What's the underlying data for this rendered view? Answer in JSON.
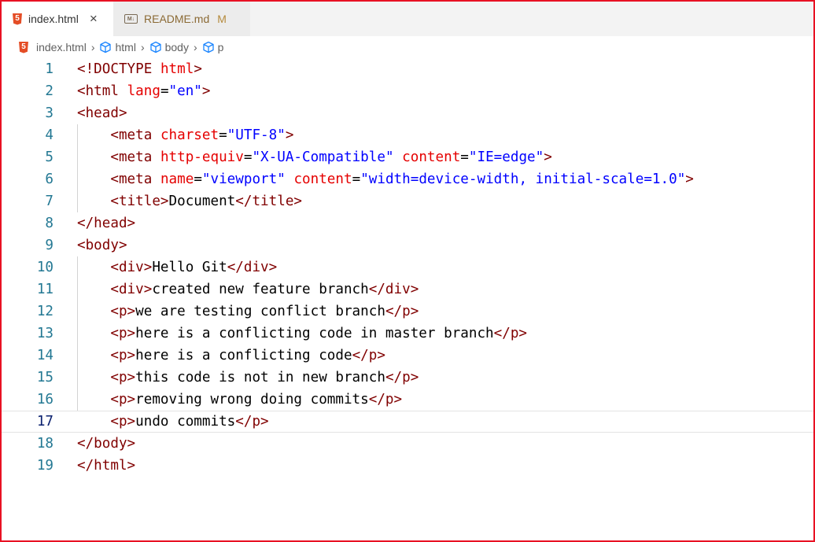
{
  "tabs": [
    {
      "label": "index.html",
      "close": "×",
      "active": true
    },
    {
      "label": "README.md",
      "status": "M",
      "active": false
    }
  ],
  "breadcrumb": [
    "index.html",
    "html",
    "body",
    "p"
  ],
  "breadcrumb_separator": "›",
  "colors": {
    "tag": "#800000",
    "attribute": "#e50000",
    "string": "#0000ff",
    "line_number": "#237893",
    "html_icon": "#e44d26",
    "frame_border": "#e81123"
  },
  "active_line": 17,
  "lines": [
    {
      "n": "1",
      "segs": [
        [
          "tg",
          "<!DOCTYPE "
        ],
        [
          "at",
          "html"
        ],
        [
          "tg",
          ">"
        ]
      ]
    },
    {
      "n": "2",
      "segs": [
        [
          "tg",
          "<html "
        ],
        [
          "at",
          "lang"
        ],
        [
          "tx",
          "="
        ],
        [
          "st",
          "\"en\""
        ],
        [
          "tg",
          ">"
        ]
      ]
    },
    {
      "n": "3",
      "segs": [
        [
          "tg",
          "<head>"
        ]
      ]
    },
    {
      "n": "4",
      "segs": [
        [
          "tx",
          "    "
        ],
        [
          "tg",
          "<meta "
        ],
        [
          "at",
          "charset"
        ],
        [
          "tx",
          "="
        ],
        [
          "st",
          "\"UTF-8\""
        ],
        [
          "tg",
          ">"
        ]
      ]
    },
    {
      "n": "5",
      "segs": [
        [
          "tx",
          "    "
        ],
        [
          "tg",
          "<meta "
        ],
        [
          "at",
          "http-equiv"
        ],
        [
          "tx",
          "="
        ],
        [
          "st",
          "\"X-UA-Compatible\""
        ],
        [
          "tx",
          " "
        ],
        [
          "at",
          "content"
        ],
        [
          "tx",
          "="
        ],
        [
          "st",
          "\"IE=edge\""
        ],
        [
          "tg",
          ">"
        ]
      ]
    },
    {
      "n": "6",
      "segs": [
        [
          "tx",
          "    "
        ],
        [
          "tg",
          "<meta "
        ],
        [
          "at",
          "name"
        ],
        [
          "tx",
          "="
        ],
        [
          "st",
          "\"viewport\""
        ],
        [
          "tx",
          " "
        ],
        [
          "at",
          "content"
        ],
        [
          "tx",
          "="
        ],
        [
          "st",
          "\"width=device-width, initial-scale=1.0\""
        ],
        [
          "tg",
          ">"
        ]
      ]
    },
    {
      "n": "7",
      "segs": [
        [
          "tx",
          "    "
        ],
        [
          "tg",
          "<title>"
        ],
        [
          "tx",
          "Document"
        ],
        [
          "tg",
          "</title>"
        ]
      ]
    },
    {
      "n": "8",
      "segs": [
        [
          "tg",
          "</head>"
        ]
      ]
    },
    {
      "n": "9",
      "segs": [
        [
          "tg",
          "<body>"
        ]
      ]
    },
    {
      "n": "10",
      "segs": [
        [
          "tx",
          "    "
        ],
        [
          "tg",
          "<div>"
        ],
        [
          "tx",
          "Hello Git"
        ],
        [
          "tg",
          "</div>"
        ]
      ]
    },
    {
      "n": "11",
      "segs": [
        [
          "tx",
          "    "
        ],
        [
          "tg",
          "<div>"
        ],
        [
          "tx",
          "created new feature branch"
        ],
        [
          "tg",
          "</div>"
        ]
      ]
    },
    {
      "n": "12",
      "segs": [
        [
          "tx",
          "    "
        ],
        [
          "tg",
          "<p>"
        ],
        [
          "tx",
          "we are testing conflict branch"
        ],
        [
          "tg",
          "</p>"
        ]
      ]
    },
    {
      "n": "13",
      "segs": [
        [
          "tx",
          "    "
        ],
        [
          "tg",
          "<p>"
        ],
        [
          "tx",
          "here is a conflicting code in master branch"
        ],
        [
          "tg",
          "</p>"
        ]
      ]
    },
    {
      "n": "14",
      "segs": [
        [
          "tx",
          "    "
        ],
        [
          "tg",
          "<p>"
        ],
        [
          "tx",
          "here is a conflicting code"
        ],
        [
          "tg",
          "</p>"
        ]
      ]
    },
    {
      "n": "15",
      "segs": [
        [
          "tx",
          "    "
        ],
        [
          "tg",
          "<p>"
        ],
        [
          "tx",
          "this code is not in new branch"
        ],
        [
          "tg",
          "</p>"
        ]
      ]
    },
    {
      "n": "16",
      "segs": [
        [
          "tx",
          "    "
        ],
        [
          "tg",
          "<p>"
        ],
        [
          "tx",
          "removing wrong doing commits"
        ],
        [
          "tg",
          "</p>"
        ]
      ]
    },
    {
      "n": "17",
      "segs": [
        [
          "tx",
          "    "
        ],
        [
          "tg",
          "<p>"
        ],
        [
          "tx",
          "undo commits"
        ],
        [
          "tg",
          "</p>"
        ]
      ]
    },
    {
      "n": "18",
      "segs": [
        [
          "tg",
          "</body>"
        ]
      ]
    },
    {
      "n": "19",
      "segs": [
        [
          "tg",
          "</html>"
        ]
      ]
    }
  ]
}
